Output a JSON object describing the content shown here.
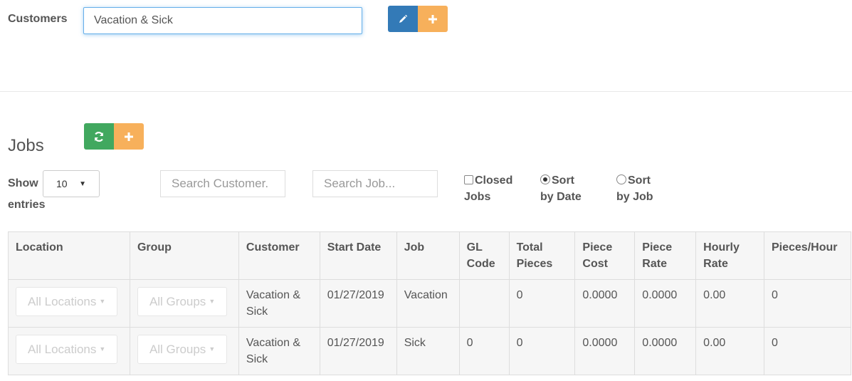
{
  "customers": {
    "label": "Customers",
    "value": "Vacation & Sick"
  },
  "icons": {
    "edit": "pencil-icon",
    "add": "plus-icon",
    "refresh": "refresh-icon"
  },
  "colors": {
    "primary": "#337ab7",
    "warning": "#f7b05b",
    "success": "#41a85f"
  },
  "jobs": {
    "title": "Jobs",
    "show_label": "Show",
    "entries_label": "entries",
    "page_size": "10",
    "search_customer_placeholder": "Search Customer.",
    "search_job_placeholder": "Search Job...",
    "closed_jobs_line1": "Closed",
    "closed_jobs_line2": "Jobs",
    "closed_jobs_checked": false,
    "sort_by_date_line1": "Sort",
    "sort_by_date_line2": "by Date",
    "sort_by_job_line1": "Sort",
    "sort_by_job_line2": "by Job",
    "sort_selected": "date"
  },
  "table": {
    "headers": [
      "Location",
      "Group",
      "Customer",
      "Start Date",
      "Job",
      "GL Code",
      "Total Pieces",
      "Piece Cost",
      "Piece Rate",
      "Hourly Rate",
      "Pieces/Hour"
    ],
    "rows": [
      {
        "location": "All Locations",
        "group": "All Groups",
        "customer": "Vacation & Sick",
        "start_date": "01/27/2019",
        "job": "Vacation",
        "gl_code": "",
        "total_pieces": "0",
        "piece_cost": "0.0000",
        "piece_rate": "0.0000",
        "hourly_rate": "0.00",
        "pieces_per_hour": "0"
      },
      {
        "location": "All Locations",
        "group": "All Groups",
        "customer": "Vacation & Sick",
        "start_date": "01/27/2019",
        "job": "Sick",
        "gl_code": "0",
        "total_pieces": "0",
        "piece_cost": "0.0000",
        "piece_rate": "0.0000",
        "hourly_rate": "0.00",
        "pieces_per_hour": "0"
      }
    ]
  }
}
